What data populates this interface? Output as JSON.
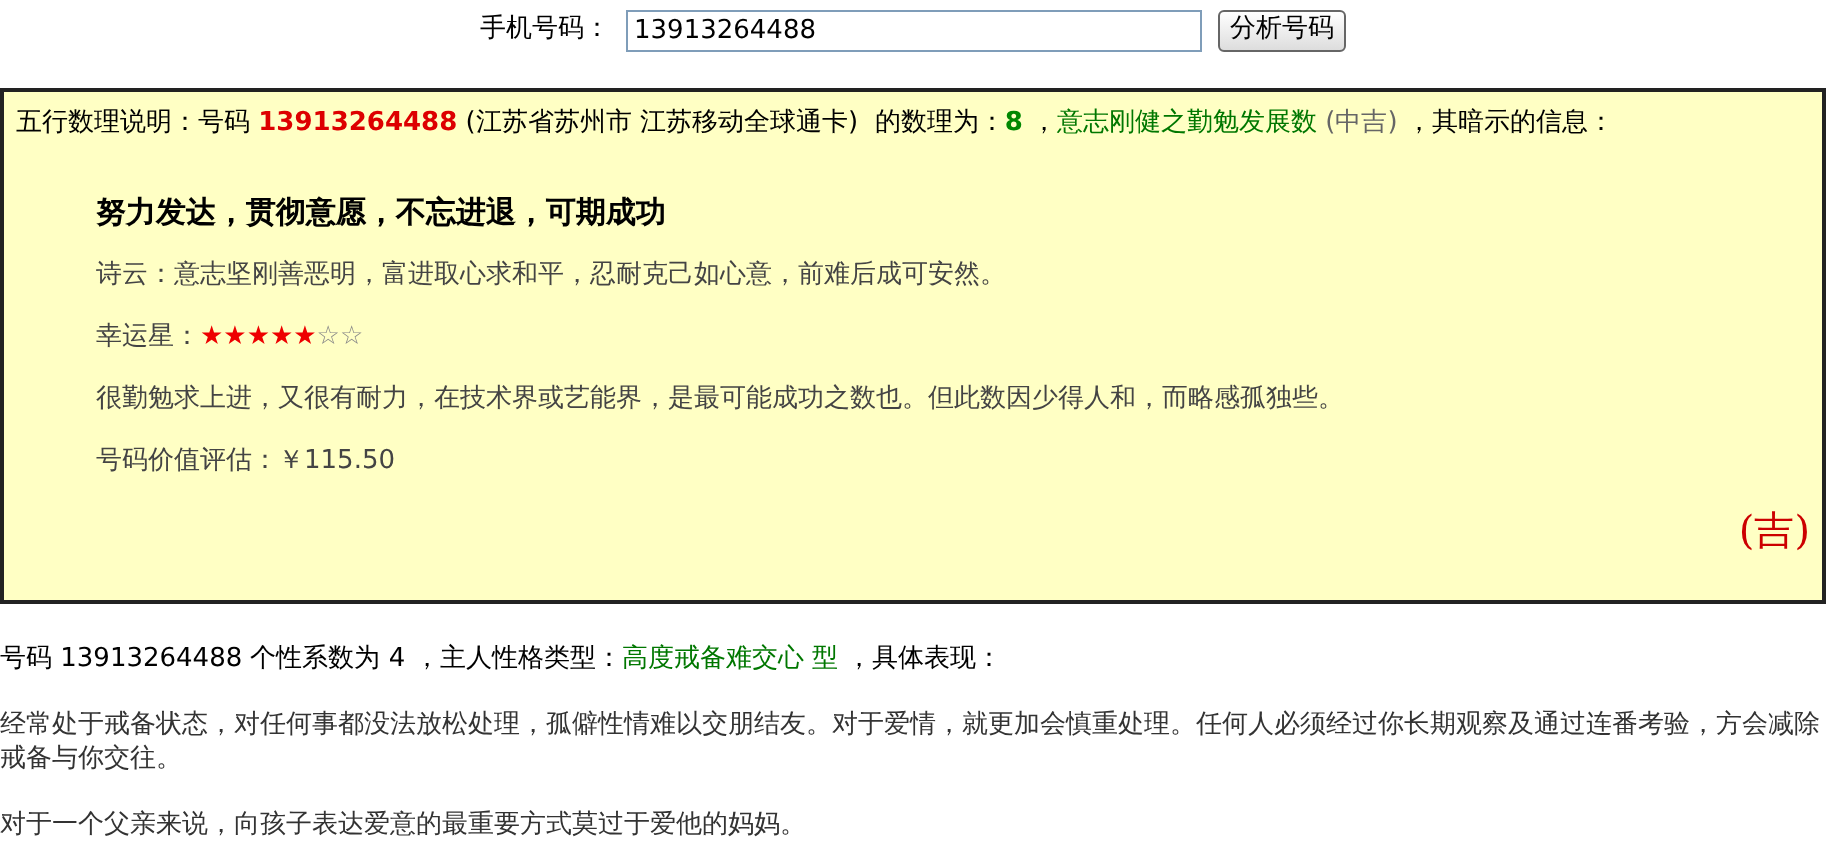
{
  "query": {
    "label": "手机号码：",
    "value": "13913264488",
    "button": "分析号码"
  },
  "result": {
    "summary": [
      {
        "kind": "plain",
        "text": "五行数理说明：号码 "
      },
      {
        "kind": "number",
        "text": "13913264488"
      },
      {
        "kind": "plain",
        "text": " (江苏省苏州市 江苏移动全球通卡)  的数理为："
      },
      {
        "kind": "score",
        "text": "8",
        "after": " ，"
      },
      {
        "kind": "meaning",
        "text": "意志刚健之勤勉发展数"
      },
      {
        "kind": "grade",
        "text": " (中吉)"
      },
      {
        "kind": "plain",
        "text": " ，其暗示的信息："
      }
    ],
    "headline": "努力发达，贯彻意愿，不忘进退，可期成功",
    "poem": "诗云：意志坚刚善恶明，富进取心求和平，忍耐克己如心意，前难后成可安然。",
    "luck_label": "幸运星：",
    "stars": 5,
    "description": "很勤勉求上进，又很有耐力，在技术界或艺能界，是最可能成功之数也。但此数因少得人和，而略感孤独些。",
    "value_label": "号码价值评估：",
    "value": "￥115.50",
    "verdict": "(吉)"
  },
  "personality": {
    "intro": [
      {
        "kind": "plain",
        "text": "号码 13913264488 个性系数为 4 ，主人性格类型："
      },
      {
        "kind": "meaning",
        "text": "高度戒备难交心 型"
      },
      {
        "kind": "plain",
        "text": " ，具体表现："
      }
    ],
    "paragraphs": [
      "经常处于戒备状态，对任何事都没法放松处理，孤僻性情难以交朋结友。对于爱情，就更加会慎重处理。任何人必须经过你长期观察及通过连番考验，方会减除戒备与你交往。",
      "对于一个父亲来说，向孩子表达爱意的最重要方式莫过于爱他的妈妈。"
    ]
  }
}
